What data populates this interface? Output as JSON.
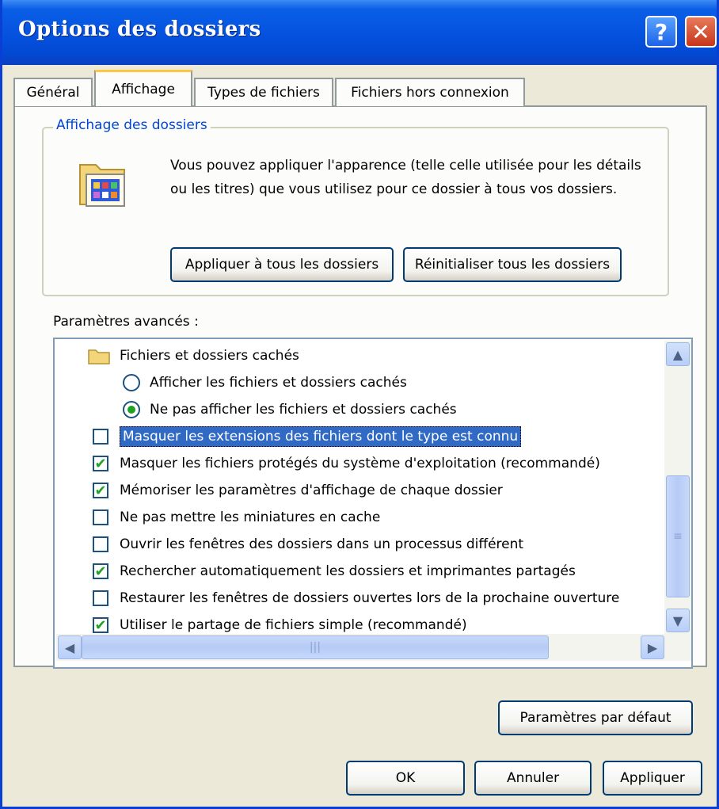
{
  "window": {
    "title": "Options des dossiers",
    "help": "?",
    "close": "✕"
  },
  "tabs": [
    {
      "label": "Général"
    },
    {
      "label": "Affichage"
    },
    {
      "label": "Types de fichiers"
    },
    {
      "label": "Fichiers hors connexion"
    }
  ],
  "folder_view": {
    "legend": "Affichage des dossiers",
    "description": "Vous pouvez appliquer l'apparence (telle celle utilisée pour les détails ou les titres) que vous utilisez pour ce dossier à tous vos dossiers.",
    "apply_all": "Appliquer à tous les dossiers",
    "reset_all": "Réinitialiser tous les dossiers"
  },
  "advanced": {
    "label": "Paramètres avancés :",
    "group_hidden": "Fichiers et dossiers cachés",
    "radio_show": {
      "label": "Afficher les fichiers et dossiers cachés",
      "selected": false
    },
    "radio_hide": {
      "label": "Ne pas afficher les fichiers et dossiers cachés",
      "selected": true
    },
    "items": [
      {
        "label": "Masquer les extensions des fichiers dont le type est connu",
        "checked": false,
        "selected": true
      },
      {
        "label": "Masquer les fichiers protégés du système d'exploitation (recommandé)",
        "checked": true
      },
      {
        "label": "Mémoriser les paramètres d'affichage de chaque dossier",
        "checked": true
      },
      {
        "label": "Ne pas mettre les miniatures en cache",
        "checked": false
      },
      {
        "label": "Ouvrir les fenêtres des dossiers dans un processus différent",
        "checked": false
      },
      {
        "label": "Rechercher automatiquement les dossiers et imprimantes partagés",
        "checked": true
      },
      {
        "label": "Restaurer les fenêtres de dossiers ouvertes lors de la prochaine ouverture",
        "checked": false
      },
      {
        "label": "Utiliser le partage de fichiers simple (recommandé)",
        "checked": true
      }
    ]
  },
  "buttons": {
    "defaults": "Paramètres par défaut",
    "ok": "OK",
    "cancel": "Annuler",
    "apply": "Appliquer"
  },
  "colors": {
    "accent": "#0553e0",
    "tab_highlight": "#ffc73c",
    "check": "#21a121",
    "selection": "#316ac5"
  }
}
